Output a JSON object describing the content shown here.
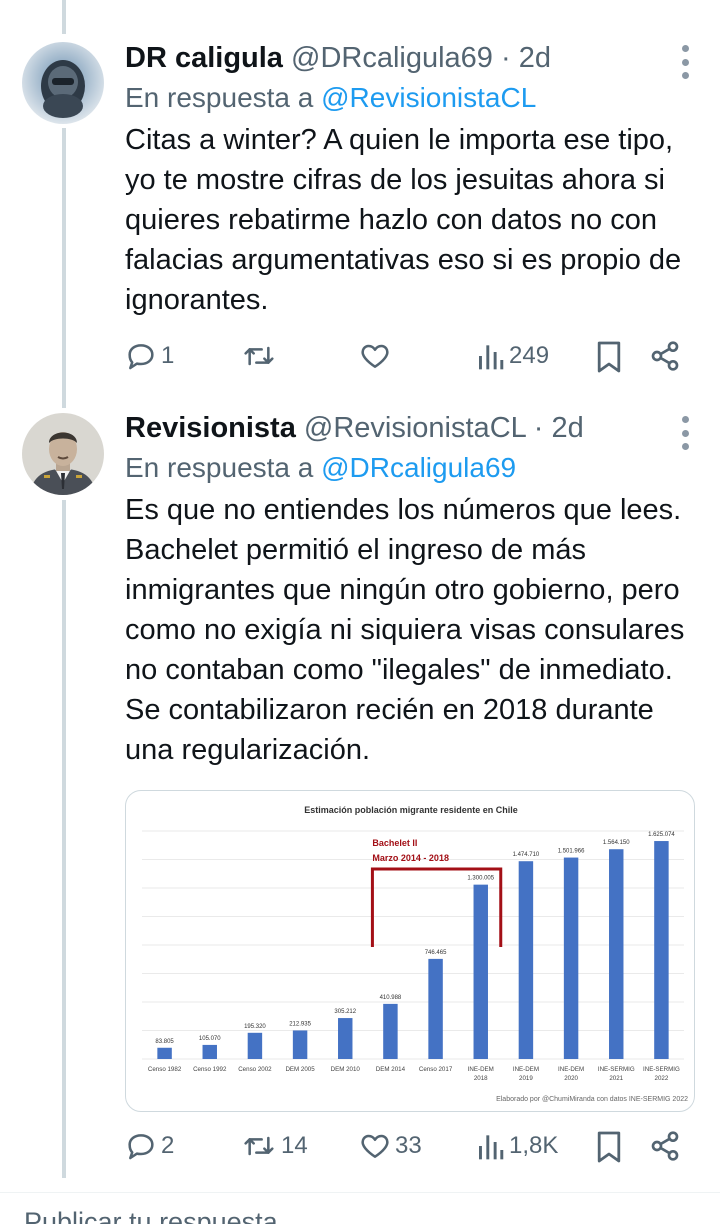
{
  "tweets": [
    {
      "display_name": "DR caligula",
      "handle": "@DRcaligula69",
      "time": "· 2d",
      "replying_label": "En respuesta a",
      "replying_to": "@RevisionistaCL",
      "text": "Citas a winter? A quien le importa ese tipo, yo te mostre cifras de los jesuitas ahora si quieres rebatirme hazlo con datos no con falacias argumentativas eso si es propio de ignorantes.",
      "replies": "1",
      "retweets": "",
      "likes": "",
      "views": "249"
    },
    {
      "display_name": "Revisionista",
      "handle": "@RevisionistaCL",
      "time": "· 2d",
      "replying_label": "En respuesta a",
      "replying_to": "@DRcaligula69",
      "text": "Es que no entiendes los números que lees. Bachelet permitió el ingreso de más inmigrantes que ningún otro gobierno, pero como no exigía ni siquiera visas consulares no contaban como \"ilegales\" de inmediato. Se contabilizaron recién en 2018 durante una regularización.",
      "replies": "2",
      "retweets": "14",
      "likes": "33",
      "views": "1,8K"
    }
  ],
  "icons": {
    "reply": "reply-icon",
    "retweet": "retweet-icon",
    "like": "heart-icon",
    "views": "views-icon",
    "bookmark": "bookmark-icon",
    "share": "share-icon",
    "more": "more-icon"
  },
  "colors": {
    "link": "#1d9bf0",
    "muted": "#536471",
    "bar": "#4472c4",
    "highlight": "#a30f16"
  },
  "reply_box": {
    "placeholder": "Publicar tu respuesta"
  },
  "chart_data": {
    "type": "bar",
    "title": "Estimación población migrante residente en Chile",
    "categories": [
      "Censo 1982",
      "Censo 1992",
      "Censo 2002",
      "DEM 2005",
      "DEM 2010",
      "DEM 2014",
      "Censo 2017",
      "INE-DEM 2018",
      "INE-DEM 2019",
      "INE-DEM 2020",
      "INE-SERMIG 2021",
      "INE-SERMIG 2022"
    ],
    "values": [
      83805,
      105070,
      195320,
      212935,
      305212,
      410988,
      746465,
      1300005,
      1474710,
      1501966,
      1564150,
      1625074
    ],
    "value_labels": [
      "83.805",
      "105.070",
      "195.320",
      "212.935",
      "305.212",
      "410.988",
      "746.465",
      "1.300.005",
      "1.474.710",
      "1.501.966",
      "1.564.150",
      "1.625.074"
    ],
    "ylim": [
      0,
      1700000
    ],
    "grid": true,
    "annotation": {
      "line1": "Bachelet II",
      "line2": "Marzo 2014 - 2018",
      "span": [
        "DEM 2014",
        "INE-DEM 2018"
      ]
    },
    "source": "Elaborado por @ChumiMiranda con datos INE-SERMIG 2022"
  }
}
